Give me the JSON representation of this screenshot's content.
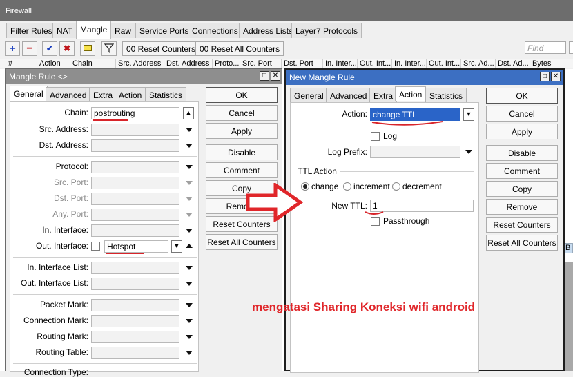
{
  "firewall": {
    "title": "Firewall",
    "tabs": [
      "Filter Rules",
      "NAT",
      "Mangle",
      "Raw",
      "Service Ports",
      "Connections",
      "Address Lists",
      "Layer7 Protocols"
    ],
    "active_tab": "Mangle",
    "toolbar": {
      "reset_counters": "00 Reset Counters",
      "reset_all_counters": "00 Reset All Counters",
      "find_placeholder": "Find"
    },
    "columns": [
      "#",
      "Action",
      "Chain",
      "Src. Address",
      "Dst. Address",
      "Proto...",
      "Src. Port",
      "Dst. Port",
      "In. Inter...",
      "Out. Int...",
      "In. Inter...",
      "Out. Int...",
      "Src. Ad...",
      "Dst. Ad...",
      "Bytes"
    ],
    "partial_cell": "B"
  },
  "mangle_rule": {
    "title": "Mangle Rule <>",
    "tabs": [
      "General",
      "Advanced",
      "Extra",
      "Action",
      "Statistics"
    ],
    "active_tab": "General",
    "fields": {
      "chain_label": "Chain:",
      "chain_value": "postrouting",
      "src_address_label": "Src. Address:",
      "dst_address_label": "Dst. Address:",
      "protocol_label": "Protocol:",
      "src_port_label": "Src. Port:",
      "dst_port_label": "Dst. Port:",
      "any_port_label": "Any. Port:",
      "in_interface_label": "In. Interface:",
      "out_interface_label": "Out. Interface:",
      "out_interface_value": "Hotspot",
      "in_interface_list_label": "In. Interface List:",
      "out_interface_list_label": "Out. Interface List:",
      "packet_mark_label": "Packet Mark:",
      "connection_mark_label": "Connection Mark:",
      "routing_mark_label": "Routing Mark:",
      "routing_table_label": "Routing Table:",
      "connection_type_label": "Connection Type:"
    },
    "buttons": [
      "OK",
      "Cancel",
      "Apply",
      "Disable",
      "Comment",
      "Copy",
      "Remove",
      "Reset Counters",
      "Reset All Counters"
    ]
  },
  "new_mangle_rule": {
    "title": "New Mangle Rule",
    "tabs": [
      "General",
      "Advanced",
      "Extra",
      "Action",
      "Statistics"
    ],
    "active_tab": "Action",
    "fields": {
      "action_label": "Action:",
      "action_value": "change TTL",
      "log_label": "Log",
      "log_prefix_label": "Log Prefix:",
      "ttl_action_title": "TTL Action",
      "radio_change": "change",
      "radio_increment": "increment",
      "radio_decrement": "decrement",
      "new_ttl_label": "New TTL:",
      "new_ttl_value": "1",
      "passthrough_label": "Passthrough"
    },
    "buttons": [
      "OK",
      "Cancel",
      "Apply",
      "Disable",
      "Comment",
      "Copy",
      "Remove",
      "Reset Counters",
      "Reset All Counters"
    ]
  },
  "caption": "mengatasi Sharing Koneksi wifi android",
  "colors": {
    "active_title": "#3c6fc2",
    "annotation_red": "#d8242a",
    "selected_field": "#2a64c8"
  }
}
